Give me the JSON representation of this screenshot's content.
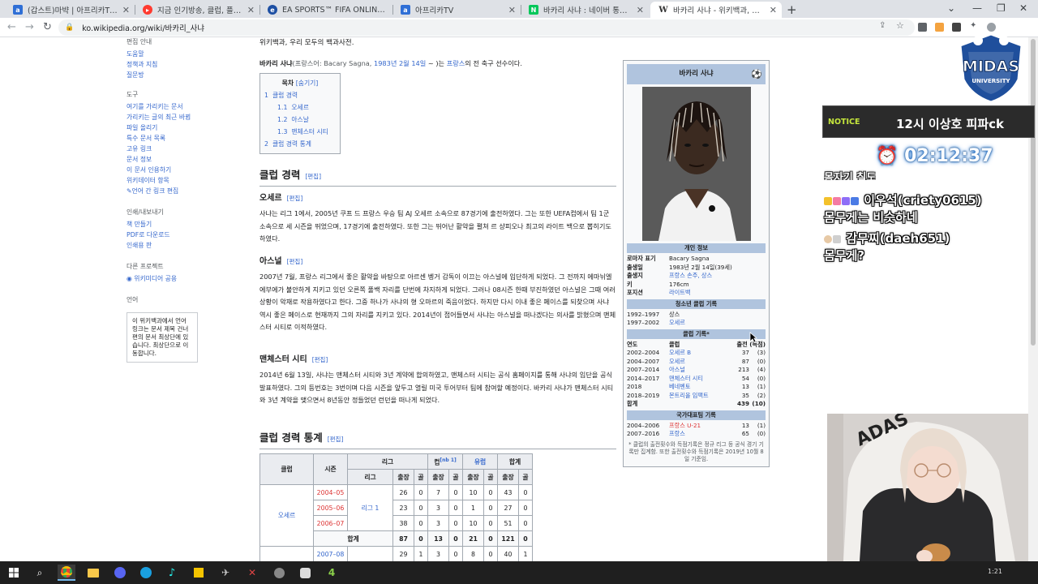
{
  "tabs": [
    {
      "label": "(갑스트)마뱍 | 아프리카TV 플레이어",
      "favicon_color": "#2f6fd6",
      "active": false
    },
    {
      "label": "지금 인기방송, 클럽, 플레이",
      "favicon_color": "#ff3b30",
      "active": false
    },
    {
      "label": "EA SPORTS™ FIFA ONLINE 4",
      "favicon_color": "#1d4fa3",
      "active": false
    },
    {
      "label": "아프리카TV",
      "favicon_color": "#2f6fd6",
      "active": false
    },
    {
      "label": "바카리 사냐 : 네이버 통합검색",
      "favicon_color": "#03c75a",
      "active": false
    },
    {
      "label": "바카리 사냐 - 위키백과, 우리 모두의 백과사전",
      "favicon_color": "#777777",
      "active": true
    }
  ],
  "url": "ko.wikipedia.org/wiki/바카리_사냐",
  "sidebar": {
    "sections": [
      {
        "heading": "편집 안내",
        "items": [
          "도움말",
          "정책과 지침",
          "질문방"
        ]
      },
      {
        "heading": "도구",
        "items": [
          "여기를 가리키는 문서",
          "가리키는 글의 최근 바뀜",
          "파일 올리기",
          "특수 문서 목록",
          "고유 링크",
          "문서 정보",
          "이 문서 인용하기",
          "위키데이터 항목",
          "언어 간 링크 편집"
        ]
      },
      {
        "heading": "인쇄/내보내기",
        "items": [
          "책 만들기",
          "PDF로 다운로드",
          "인쇄용 판"
        ]
      },
      {
        "heading": "다른 프로젝트",
        "items": [
          "위키미디어 공용"
        ]
      },
      {
        "heading": "언어",
        "items": []
      }
    ],
    "lang_note": "이 위키백과에서 언어 링크는 문서 제목 건너편의 문서 최상단에 있습니다. 최상단으로 이동합니다."
  },
  "article": {
    "tagline": "위키백과, 우리 모두의 백과사전.",
    "lead": {
      "name": "바카리 사냐",
      "native_open": "(프랑스어: Bacary Sagna, ",
      "birth": "1983년 2월 14일",
      "native_close": " ~ )",
      "rest_1": "는 ",
      "country": "프랑스",
      "rest_2": "의 전 축구 선수이다."
    },
    "toc": {
      "title": "목차",
      "hide": "[숨기기]",
      "items": [
        {
          "num": "1",
          "label": "클럽 경력",
          "level": 1
        },
        {
          "num": "1.1",
          "label": "오세르",
          "level": 2
        },
        {
          "num": "1.2",
          "label": "아스날",
          "level": 2
        },
        {
          "num": "1.3",
          "label": "맨체스터 시티",
          "level": 2
        },
        {
          "num": "2",
          "label": "클럽 경력 통계",
          "level": 1
        }
      ]
    },
    "edit_label": "[편집]",
    "h_club_career": "클럽 경력",
    "h_auxerre": "오세르",
    "p_auxerre": "사냐는 리그 1에서, 2005년 쿠프 드 프랑스 우승 팀 AJ 오세르 소속으로 87경기에 출전하였다. 그는 또한 UEFA컵에서 팀 1군 소속으로 세 시즌을 뛰었으며, 17경기에 출전하였다. 또한 그는 뛰어난 활약을 펼쳐 르 샹피오나 최고의 라이트 백으로 뽑히기도 하였다.",
    "h_arsenal": "아스널",
    "p_arsenal": "2007년 7월, 프랑스 리그에서 좋은 활약을 바탕으로 아르센 벵거 감독이 이끄는 아스널에 입단하게 되었다. 그 전까지 에마뉘엘 에부에가 불안하게 지키고 있던 오른쪽 풀백 자리를 단번에 차지하게 되었다. 그러나 08시즌 한때 부진하였던 아스널은 그때 여러 상황이 악재로 작용하였다고 한다. 그중 하나가 사냐의 형 오마르의 죽음이었다. 하지만 다시 이내 좋은 페이스를 되찾으며 사냐 역시 좋은 페이스로 현재까지 그의 자리를 지키고 있다. 2014년이 접어들면서 사냐는 아스널을 떠나겠다는 의사를 밝혔으며 맨체스터 시티로 이적하였다.",
    "h_mancity": "맨체스터 시티",
    "p_mancity": "2014년 6월 13일, 사냐는 맨체스터 시티와 3년 계약에 합의하였고, 맨체스터 시티는 공식 홈페이지를 통해 사냐의 입단을 공식 발표하였다. 그의 등번호는 3번이며 다음 시즌을 앞두고 열릴 미국 투어부터 팀에 참여할 예정이다. 바카리 사냐가 맨체스터 시티와 3년 계약을 맺으면서 8년동안 정들었던 런던을 떠나게 되었다.",
    "h_stats": "클럽 경력 통계",
    "stats": {
      "headers": {
        "club": "클럽",
        "season": "시즌",
        "league": "리그",
        "cup": "컵",
        "cup_note": "[nb 1]",
        "europe": "유럽",
        "total": "합계",
        "league_sub": "리그",
        "apps": "출장",
        "goals": "골"
      },
      "club_name": "오세르",
      "league_name": "리그 1",
      "rows": [
        [
          "2004–05",
          "26",
          "0",
          "7",
          "0",
          "10",
          "0",
          "43",
          "0"
        ],
        [
          "2005–06",
          "23",
          "0",
          "3",
          "0",
          "1",
          "0",
          "27",
          "0"
        ],
        [
          "2006–07",
          "38",
          "0",
          "3",
          "0",
          "10",
          "0",
          "51",
          "0"
        ]
      ],
      "subtotal": {
        "label": "합계",
        "values": [
          "87",
          "0",
          "13",
          "0",
          "21",
          "0",
          "121",
          "0"
        ]
      },
      "last_row": [
        "2007–08",
        "29",
        "1",
        "3",
        "0",
        "8",
        "0",
        "40",
        "1"
      ]
    }
  },
  "infobox": {
    "title": "바카리 사냐",
    "personal_heading": "개인 정보",
    "personal": [
      {
        "k": "로마자 표기",
        "v": "Bacary Sagna"
      },
      {
        "k": "출생일",
        "v": "1983년 2월 14일(39세)"
      },
      {
        "k": "출생지",
        "v": "프랑스 손주, 상스"
      },
      {
        "k": "키",
        "v": "176cm"
      },
      {
        "k": "포지션",
        "v": "라이트백"
      }
    ],
    "youth_heading": "청소년 클럽 기록",
    "youth": [
      {
        "y": "1992–1997",
        "c": "상스"
      },
      {
        "y": "1997–2002",
        "c": "오세르"
      }
    ],
    "club_heading": "클럽 기록*",
    "club_cols": {
      "y": "연도",
      "c": "클럽",
      "a": "출전 (득점)"
    },
    "clubs": [
      {
        "y": "2002–2004",
        "c": "오세르 B",
        "a": "37",
        "g": "(3)"
      },
      {
        "y": "2004–2007",
        "c": "오세르",
        "a": "87",
        "g": "(0)"
      },
      {
        "y": "2007–2014",
        "c": "아스널",
        "a": "213",
        "g": "(4)"
      },
      {
        "y": "2014–2017",
        "c": "맨체스터 시티",
        "a": "54",
        "g": "(0)"
      },
      {
        "y": "2018",
        "c": "베네벤토",
        "a": "13",
        "g": "(1)"
      },
      {
        "y": "2018–2019",
        "c": "몬트리올 임팩트",
        "a": "35",
        "g": "(2)"
      }
    ],
    "club_total": {
      "y": "합계",
      "a": "439",
      "g": "(10)"
    },
    "national_heading": "국가대표팀 기록",
    "national": [
      {
        "y": "2004–2006",
        "c": "프랑스 U-21",
        "a": "13",
        "g": "(1)"
      },
      {
        "y": "2007–2016",
        "c": "프랑스",
        "a": "65",
        "g": "(0)"
      }
    ],
    "note": "* 클럽의 출전횟수와 득점기록은 정규 리그 등 공식 경기 기록만 집계함. 또한 출전횟수와 득점기록은 2019년 10월 8일 기준임."
  },
  "overlay": {
    "logo_top": "MIDAS",
    "logo_bottom": "UNIVERSITY",
    "notice_label": "NOTICE",
    "notice_text": "12시 이상호 피파ck",
    "timer": "02:12:37",
    "chat_partial": "몸자기 칠도",
    "chat": [
      {
        "user": "이우석(criety0615)",
        "msg": "몸무게는 비슷하네"
      },
      {
        "user": "감무찌(daeh651)",
        "msg": "몸무게?"
      }
    ],
    "webcam_hood_text": "ADAS"
  },
  "taskbar": {
    "clock": "1:21"
  }
}
